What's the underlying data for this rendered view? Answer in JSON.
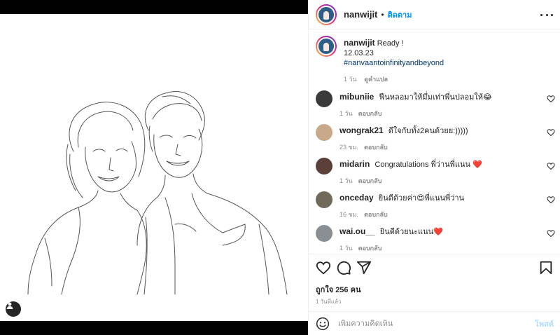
{
  "post": {
    "author": "nanwijit",
    "follow_label": "ติดตาม",
    "dot": "•"
  },
  "caption": {
    "username": "nanwijit",
    "text": "Ready !",
    "date": "12.03.23",
    "hashtag": "#nanvaantoinfinityandbeyond",
    "time": "1 วัน",
    "see_translation": "ดูคำแปล"
  },
  "comments": [
    {
      "username": "mibuniie",
      "text": "ฟีนหลอมาให้มึ่มเท่าพึ่นปลอมให้😂",
      "time": "1 วัน",
      "reply": "ตอบกลับ",
      "avatar_color": "#3a3a3a"
    },
    {
      "username": "wongrak21",
      "text": "ดีใจกับทั้ง2คนด้วยย:)))))",
      "time": "23 ชม.",
      "reply": "ตอบกลับ",
      "avatar_color": "#c8a98a"
    },
    {
      "username": "midarin",
      "text": "Congratulations พี่ว่านพี่แนน ❤️",
      "time": "1 วัน",
      "reply": "ตอบกลับ",
      "avatar_color": "#5a4038"
    },
    {
      "username": "onceday",
      "text": "ยินดีด้วยค่า😍พี่แนนพี่ว่าน",
      "time": "16 ชม.",
      "reply": "ตอบกลับ",
      "avatar_color": "#6f6a5a"
    },
    {
      "username": "wai.ou__",
      "text": "ยินดีด้วยนะแนน❤️",
      "time": "1 วัน",
      "reply": "ตอบกลับ",
      "avatar_color": "#8a8f94"
    }
  ],
  "actions": {
    "likes": "ถูกใจ 256 คน",
    "time_ago": "1 วันที่แล้ว"
  },
  "compose": {
    "placeholder": "เพิ่มความคิดเห็น",
    "post_label": "โพสต์"
  },
  "icons": {
    "like": "heart-icon",
    "comment": "comment-icon",
    "share": "share-icon",
    "save": "bookmark-icon",
    "emoji": "emoji-icon",
    "more": "more-icon",
    "tag": "user-tag-icon"
  },
  "colors": {
    "accent": "#0095f6",
    "post_disabled": "#b2dffc",
    "hashtag": "#00376b",
    "muted": "#8e8e8e"
  }
}
